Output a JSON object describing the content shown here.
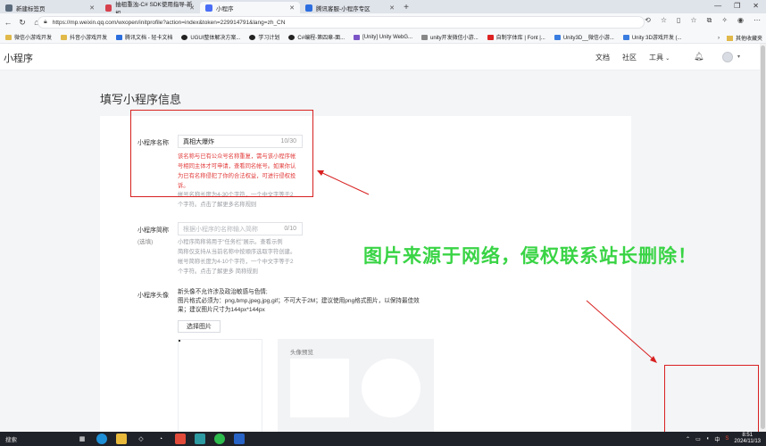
{
  "browser": {
    "tabs": [
      {
        "label": "新建标签页",
        "color": "#5b6b7c"
      },
      {
        "label": "抽祖重浊-C# SDK使用指导-新机...",
        "color": "#d6404c"
      },
      {
        "label": "小程序",
        "color": "#4a6ef5"
      },
      {
        "label": "腾讯客服-小程序专区",
        "color": "#2c6ee0"
      }
    ],
    "new_tab": "+",
    "url": "https://mp.weixin.qq.com/wxopen/initprofile?action=index&token=229914791&lang=zh_CN",
    "bookmarks": [
      {
        "label": "微信小游戏开发",
        "color": "#e0b94a"
      },
      {
        "label": "抖音小游戏开发",
        "color": "#e0b94a"
      },
      {
        "label": "腾讯文档 - 轻卡文档",
        "color": "#2a6ede"
      },
      {
        "label": "UGUI整体解决方案...",
        "color": "#222"
      },
      {
        "label": "学习计划",
        "color": "#222"
      },
      {
        "label": "C#编程-第四章-面...",
        "color": "#222"
      },
      {
        "label": "[Unity] Unity WebG...",
        "color": "#7b55c7"
      },
      {
        "label": "unity开发微信小游...",
        "color": "#888"
      },
      {
        "label": "自制字体库 | Font |...",
        "color": "#d22"
      },
      {
        "label": "Unity3D__微信小游...",
        "color": "#3a7de0"
      },
      {
        "label": "Unity 3D游戏开发 (...",
        "color": "#3a7de0"
      }
    ],
    "bookmark_more": "其他收藏夹"
  },
  "app": {
    "title": "小程序",
    "nav": [
      "文档",
      "社区",
      "工具"
    ]
  },
  "page": {
    "title": "填写小程序信息",
    "name_field": {
      "label": "小程序名称",
      "value": "真相大爆炸",
      "count": "10/30",
      "error_lines": [
        "该名称与已有公众号名称重复，需与该小程序帐",
        "号相同主体才可申请，查看同名帐号。如果你认",
        "为已有名称侵犯了你的合法权益，可进行侵权投",
        "诉。"
      ],
      "hint_lines": [
        "帐号名称长度为4-30个字符，一个中文字等于2",
        "个字符。点击了解更多名称规则"
      ]
    },
    "short_field": {
      "label": "小程序简称",
      "sub": "(选填)",
      "placeholder": "根据小程序的名称输入简称",
      "count": "0/10",
      "hint_lines": [
        "小程序简称将用于“任务栏”展示。查看示例",
        "简称仅支持从当前名称中按顺序选取字符创建。",
        "帐号简称长度为4-10个字符，一个中文字等于2",
        "个字符。点击了解更多 简称规则"
      ]
    },
    "avatar_field": {
      "label": "小程序头像",
      "desc_lines": [
        "新头像不允许涉及政治敏感与色情;",
        "图片格式必须为：png,bmp,jpeg,jpg,gif；不可大于2M；建议使用png格式图片，以保持最佳效",
        "果；建议图片尺寸为144px*144px"
      ],
      "button": "选择图片",
      "preview_label": "头像预览"
    }
  },
  "watermark": "图片来源于网络，侵权联系站长删除！",
  "taskbar": {
    "search": "搜索",
    "time": "8:51",
    "date": "2024/11/13",
    "ime": "中"
  }
}
